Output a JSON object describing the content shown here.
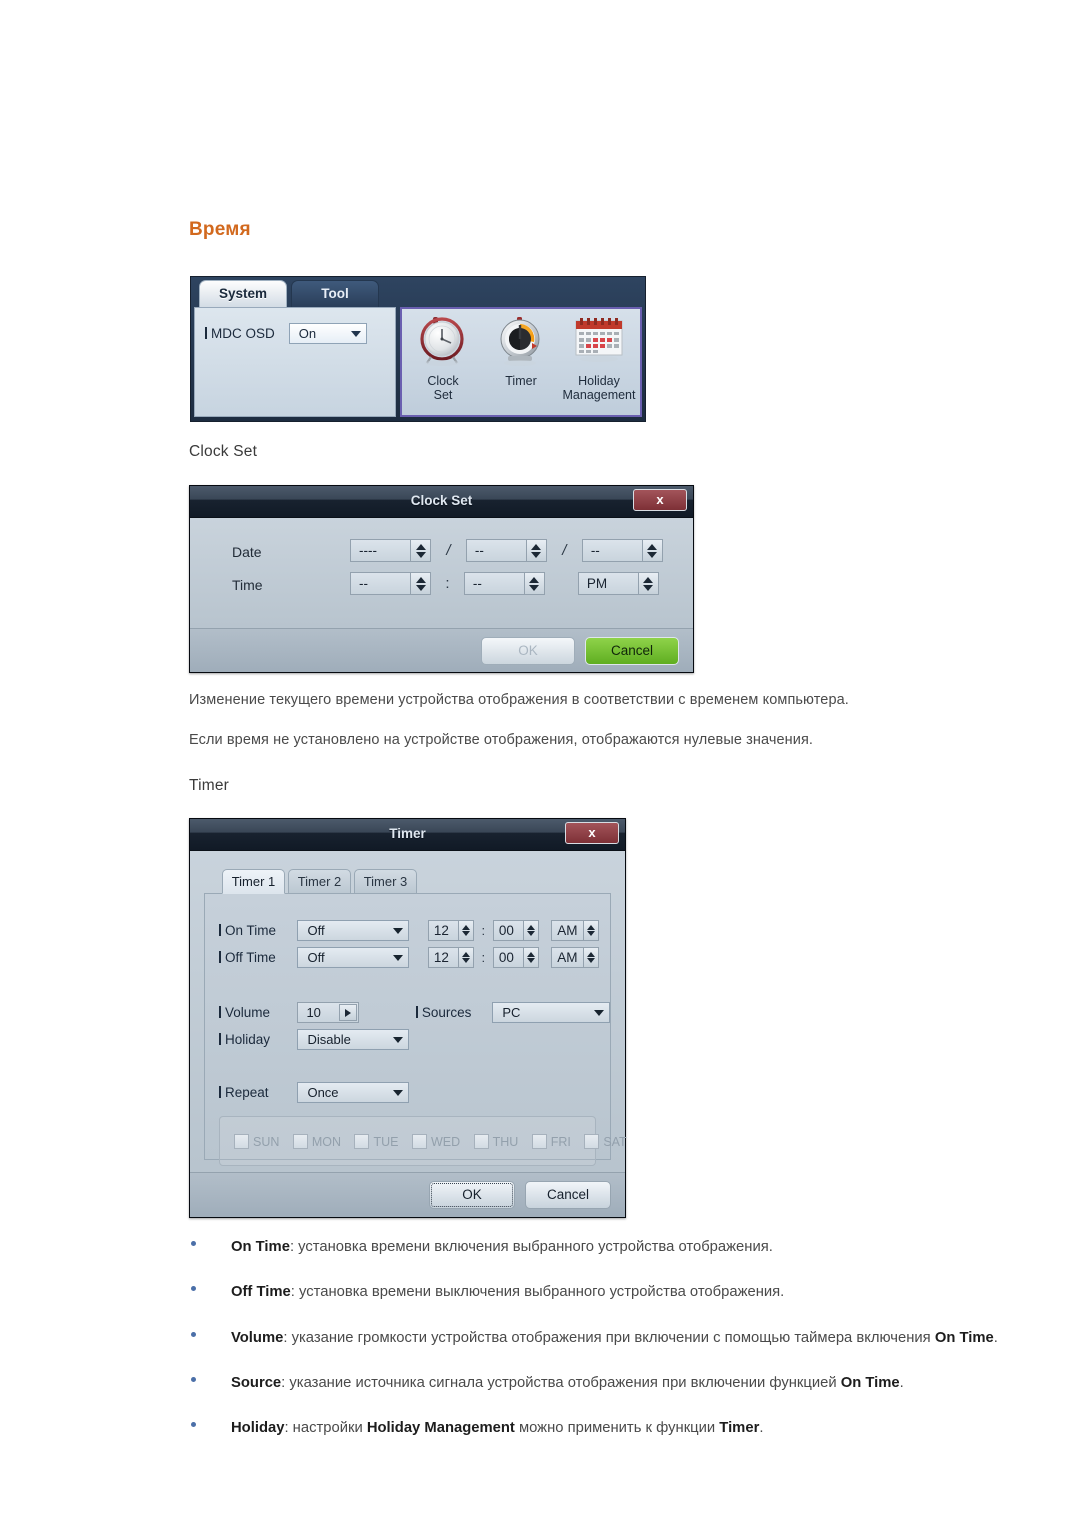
{
  "section": {
    "heading": "Время"
  },
  "system_panel": {
    "tabs": [
      {
        "label": "System",
        "active": true
      },
      {
        "label": "Tool",
        "active": false
      }
    ],
    "osd": {
      "label": "MDC OSD",
      "value": "On"
    },
    "icons": [
      {
        "name": "clock-set-icon",
        "caption_line1": "Clock",
        "caption_line2": "Set"
      },
      {
        "name": "timer-icon",
        "caption_line1": "Timer",
        "caption_line2": ""
      },
      {
        "name": "holiday-management-icon",
        "caption_line1": "Holiday",
        "caption_line2": "Management"
      }
    ],
    "highlight_color": "#6a5fb0"
  },
  "clock_set": {
    "subheading": "Clock Set",
    "title": "Clock Set",
    "close_label": "x",
    "rows": [
      {
        "label": "Date",
        "fields": [
          {
            "value": "----"
          },
          {
            "value": "--"
          },
          {
            "value": "--"
          }
        ],
        "separators": [
          "/",
          "/"
        ]
      },
      {
        "label": "Time",
        "fields": [
          {
            "value": "--"
          },
          {
            "value": "--"
          },
          {
            "value": "PM"
          }
        ],
        "separators": [
          ":",
          ""
        ]
      }
    ],
    "ok_label": "OK",
    "cancel_label": "Cancel",
    "ok_disabled": true,
    "cancel_color": "#6fbd2d"
  },
  "paragraphs": [
    "Изменение текущего времени устройства отображения в соответствии с временем компьютера.",
    "Если время не установлено на устройстве отображения, отображаются нулевые значения."
  ],
  "timer": {
    "subheading": "Timer",
    "title": "Timer",
    "close_label": "x",
    "tabs": [
      {
        "label": "Timer 1",
        "active": true
      },
      {
        "label": "Timer 2",
        "active": false
      },
      {
        "label": "Timer 3",
        "active": false
      }
    ],
    "on_time": {
      "label": "On Time",
      "mode": "Off",
      "hour": "12",
      "minute": "00",
      "meridiem": "AM"
    },
    "off_time": {
      "label": "Off Time",
      "mode": "Off",
      "hour": "12",
      "minute": "00",
      "meridiem": "AM"
    },
    "volume": {
      "label": "Volume",
      "value": "10"
    },
    "sources": {
      "label": "Sources",
      "value": "PC"
    },
    "holiday": {
      "label": "Holiday",
      "value": "Disable"
    },
    "repeat": {
      "label": "Repeat",
      "value": "Once"
    },
    "days": [
      {
        "label": "SUN",
        "checked": false
      },
      {
        "label": "MON",
        "checked": false
      },
      {
        "label": "TUE",
        "checked": false
      },
      {
        "label": "WED",
        "checked": false
      },
      {
        "label": "THU",
        "checked": false
      },
      {
        "label": "FRI",
        "checked": false
      },
      {
        "label": "SAT",
        "checked": false
      }
    ],
    "ok_label": "OK",
    "cancel_label": "Cancel"
  },
  "bullets": [
    {
      "term": "On Time",
      "rest": ": установка времени включения выбранного устройства отображения."
    },
    {
      "term": "Off Time",
      "rest": ": установка времени выключения выбранного устройства отображения."
    },
    {
      "term": "Volume",
      "rest": ": указание громкости устройства отображения при включении с помощью таймера включения ",
      "term2": "On Time",
      "tail": "."
    },
    {
      "term": "Source",
      "rest": ": указание источника сигнала устройства отображения при включении функцией ",
      "term2": "On Time",
      "tail": "."
    },
    {
      "term": "Holiday",
      "rest": ": настройки ",
      "term2": "Holiday Management",
      "mid": " можно применить к функции ",
      "term3": "Timer",
      "tail": "."
    }
  ]
}
